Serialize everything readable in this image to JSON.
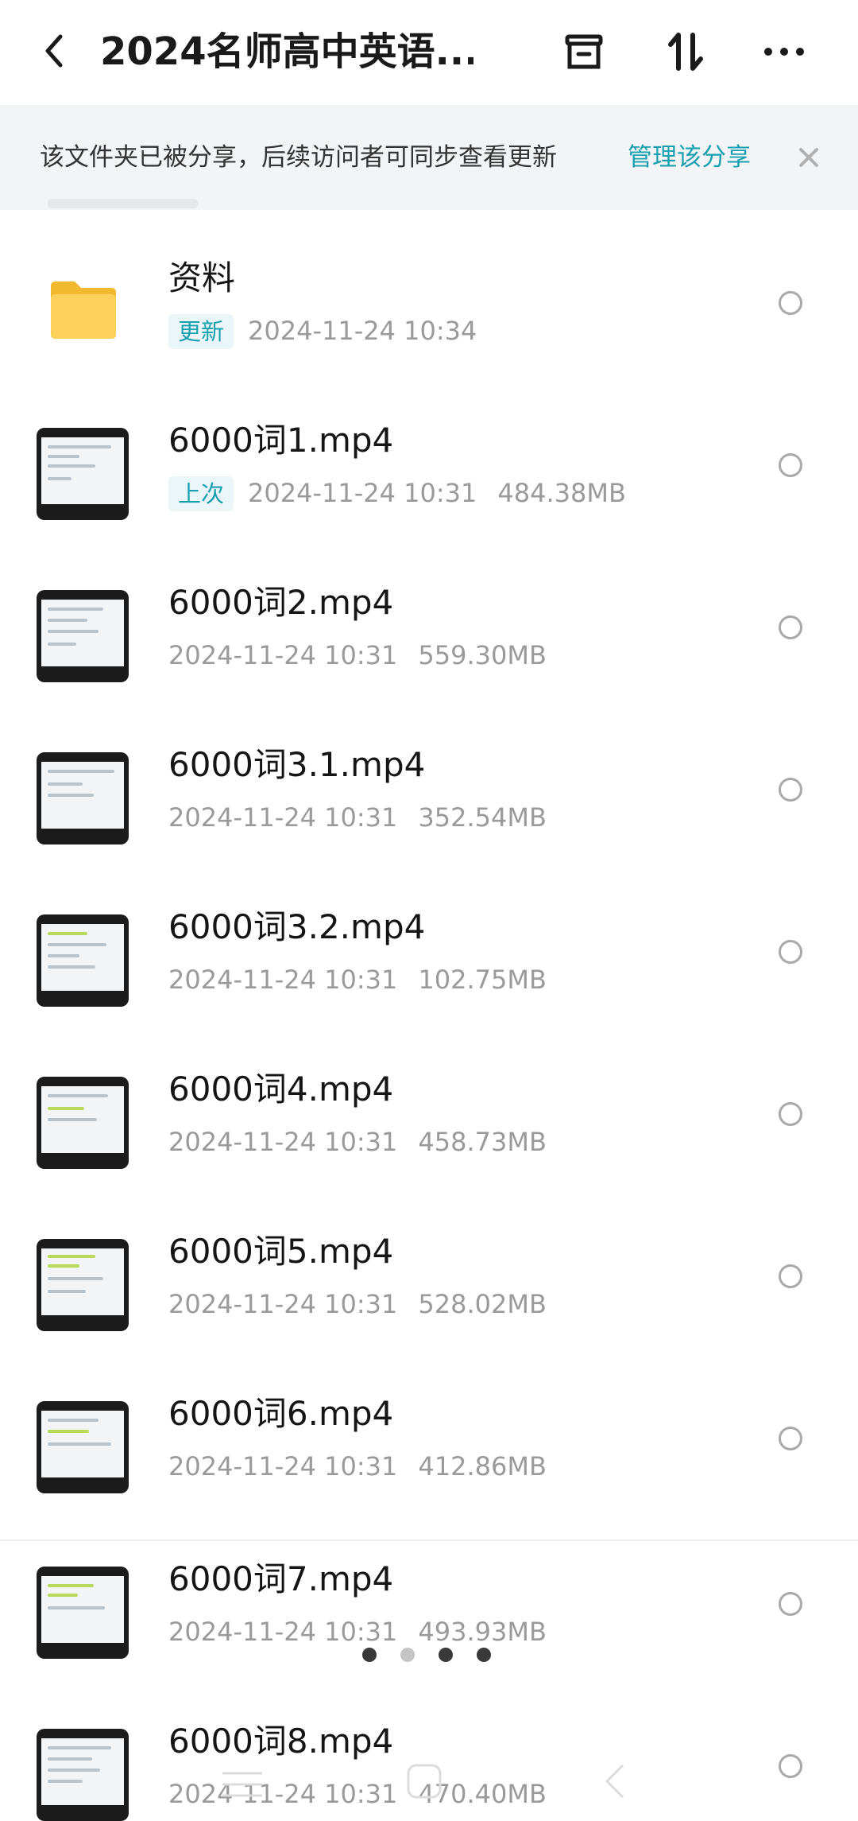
{
  "header": {
    "title": "2024名师高中英语...",
    "icons": [
      "back-icon",
      "archive-icon",
      "sort-icon",
      "more-icon"
    ]
  },
  "banner": {
    "text": "该文件夹已被分享，后续访问者可同步查看更新",
    "link": "管理该分享"
  },
  "files": [
    {
      "name": "资料",
      "tag": "更新",
      "date": "2024-11-24  10:34",
      "size": "",
      "type": "folder"
    },
    {
      "name": "6000词1.mp4",
      "tag": "上次",
      "date": "2024-11-24  10:31",
      "size": "484.38MB",
      "type": "video"
    },
    {
      "name": "6000词2.mp4",
      "tag": "",
      "date": "2024-11-24  10:31",
      "size": "559.30MB",
      "type": "video"
    },
    {
      "name": "6000词3.1.mp4",
      "tag": "",
      "date": "2024-11-24  10:31",
      "size": "352.54MB",
      "type": "video"
    },
    {
      "name": "6000词3.2.mp4",
      "tag": "",
      "date": "2024-11-24  10:31",
      "size": "102.75MB",
      "type": "video"
    },
    {
      "name": "6000词4.mp4",
      "tag": "",
      "date": "2024-11-24  10:31",
      "size": "458.73MB",
      "type": "video"
    },
    {
      "name": "6000词5.mp4",
      "tag": "",
      "date": "2024-11-24  10:31",
      "size": "528.02MB",
      "type": "video"
    },
    {
      "name": "6000词6.mp4",
      "tag": "",
      "date": "2024-11-24  10:31",
      "size": "412.86MB",
      "type": "video"
    },
    {
      "name": "6000词7.mp4",
      "tag": "",
      "date": "2024-11-24  10:31",
      "size": "493.93MB",
      "type": "video"
    },
    {
      "name": "6000词8.mp4",
      "tag": "",
      "date": "2024-11-24  10:31",
      "size": "470.40MB",
      "type": "video"
    }
  ],
  "colors": {
    "accent": "#1a9fb0",
    "folder": "#f7c948",
    "meta": "#9a9a9a"
  }
}
